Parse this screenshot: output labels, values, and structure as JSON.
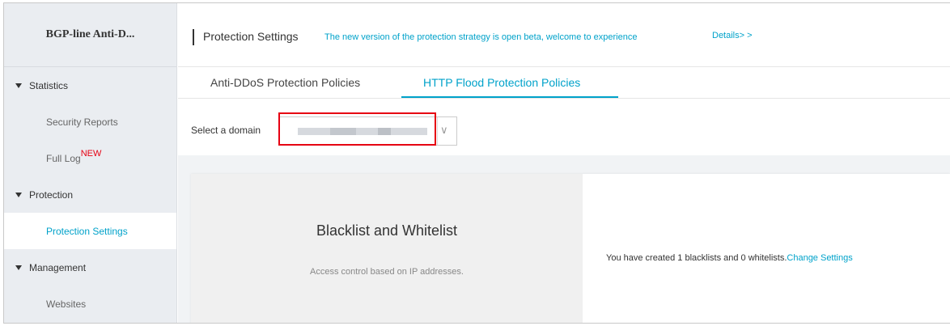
{
  "sidebar": {
    "title": "BGP-line Anti-D...",
    "groups": [
      {
        "label": "Statistics",
        "items": [
          {
            "label": "Security Reports"
          },
          {
            "label": "Full Log",
            "badge": "NEW"
          }
        ]
      },
      {
        "label": "Protection",
        "items": [
          {
            "label": "Protection Settings"
          }
        ]
      },
      {
        "label": "Management",
        "items": [
          {
            "label": "Websites"
          }
        ]
      }
    ],
    "active_item": "Protection Settings"
  },
  "header": {
    "title": "Protection Settings",
    "notice": "The new version of the protection strategy is open beta, welcome to experience",
    "details_link": "Details> >"
  },
  "tabs": [
    {
      "label": "Anti-DDoS Protection Policies"
    },
    {
      "label": "HTTP Flood Protection Policies"
    }
  ],
  "active_tab": "HTTP Flood Protection Policies",
  "domain_selector": {
    "label": "Select a domain",
    "value": "",
    "arrow_icon": "chevron-down-icon"
  },
  "card": {
    "title": "Blacklist and Whitelist",
    "description": "Access control based on IP addresses.",
    "status_text": "You have created 1 blacklists and 0 whitelists.",
    "link": "Change Settings"
  },
  "colors": {
    "accent": "#00a2ca",
    "highlight": "#e60012",
    "sidebar_bg": "#eaedf1"
  }
}
